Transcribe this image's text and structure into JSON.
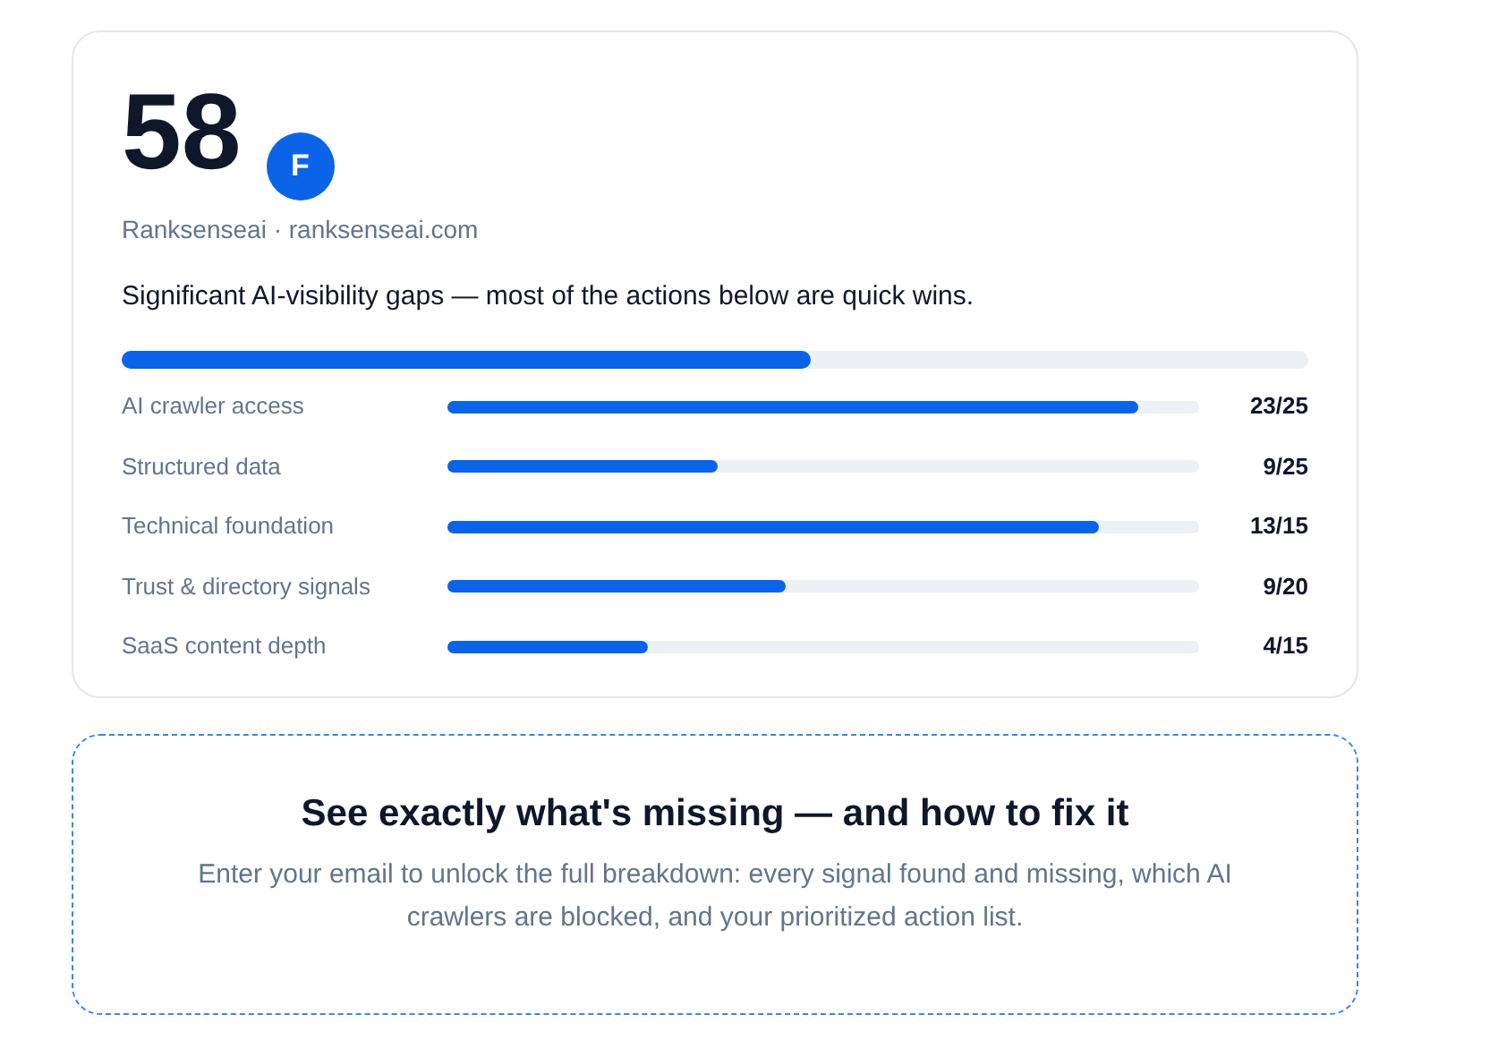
{
  "score": {
    "value": "58",
    "grade": "F",
    "site": "Ranksenseai · ranksenseai.com",
    "summary": "Significant AI-visibility gaps — most of the actions below are quick wins.",
    "level": 0.58
  },
  "categories": [
    {
      "label": "AI crawler access",
      "level": 0.92,
      "reading": "23/25"
    },
    {
      "label": "Structured data",
      "level": 0.36,
      "reading": "9/25"
    },
    {
      "label": "Technical foundation",
      "level": 0.867,
      "reading": "13/15"
    },
    {
      "label": "Trust & directory signals",
      "level": 0.45,
      "reading": "9/20"
    },
    {
      "label": "SaaS content depth",
      "level": 0.267,
      "reading": "4/15"
    }
  ],
  "unlock": {
    "title": "See exactly what's missing — and how to fix it",
    "text": "Enter your email to unlock the full breakdown: every signal found and missing, which AI crawlers are blocked, and your prioritized action list."
  }
}
